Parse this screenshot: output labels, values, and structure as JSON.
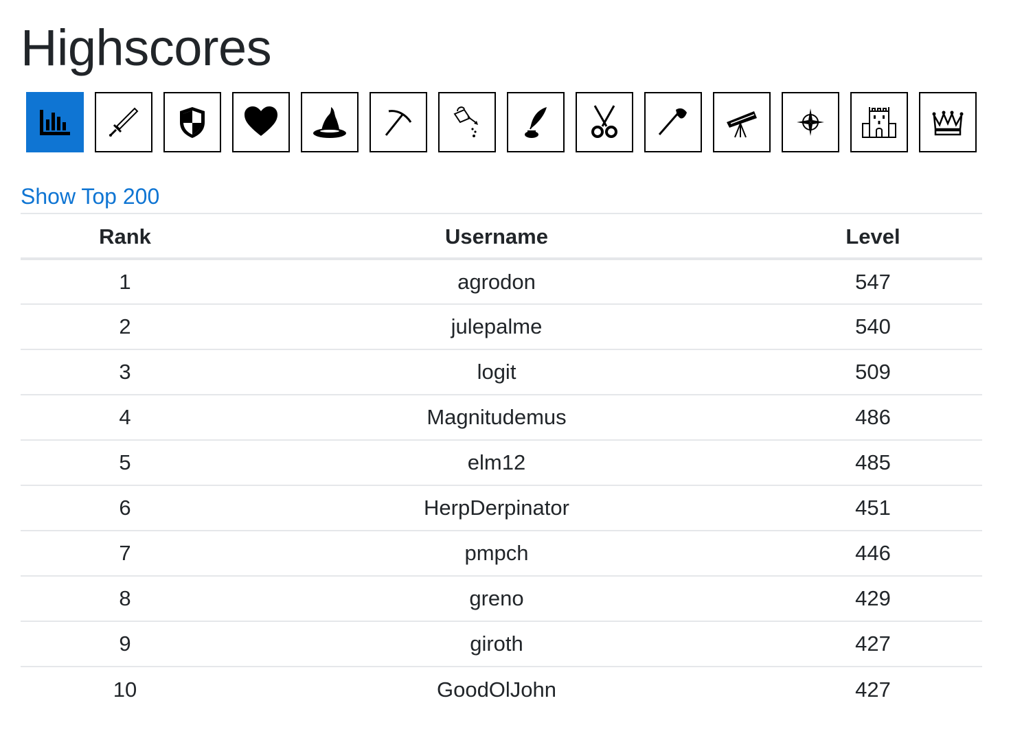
{
  "page": {
    "title": "Highscores"
  },
  "skills": [
    {
      "icon": "bar-chart-icon",
      "active": true
    },
    {
      "icon": "sword-icon",
      "active": false
    },
    {
      "icon": "shield-icon",
      "active": false
    },
    {
      "icon": "heart-icon",
      "active": false
    },
    {
      "icon": "wizard-hat-icon",
      "active": false
    },
    {
      "icon": "pickaxe-icon",
      "active": false
    },
    {
      "icon": "watering-can-icon",
      "active": false
    },
    {
      "icon": "quill-ink-icon",
      "active": false
    },
    {
      "icon": "scissors-icon",
      "active": false
    },
    {
      "icon": "axe-icon",
      "active": false
    },
    {
      "icon": "telescope-icon",
      "active": false
    },
    {
      "icon": "compass-icon",
      "active": false
    },
    {
      "icon": "castle-tower-icon",
      "active": false
    },
    {
      "icon": "crown-icon",
      "active": false
    }
  ],
  "show_top_link": "Show Top 200",
  "table": {
    "headers": {
      "rank": "Rank",
      "username": "Username",
      "level": "Level"
    },
    "rows": [
      {
        "rank": "1",
        "username": "agrodon",
        "level": "547"
      },
      {
        "rank": "2",
        "username": "julepalme",
        "level": "540"
      },
      {
        "rank": "3",
        "username": "logit",
        "level": "509"
      },
      {
        "rank": "4",
        "username": "Magnitudemus",
        "level": "486"
      },
      {
        "rank": "5",
        "username": "elm12",
        "level": "485"
      },
      {
        "rank": "6",
        "username": "HerpDerpinator",
        "level": "451"
      },
      {
        "rank": "7",
        "username": "pmpch",
        "level": "446"
      },
      {
        "rank": "8",
        "username": "greno",
        "level": "429"
      },
      {
        "rank": "9",
        "username": "giroth",
        "level": "427"
      },
      {
        "rank": "10",
        "username": "GoodOlJohn",
        "level": "427"
      }
    ]
  },
  "colors": {
    "accent": "#0f75d3",
    "text": "#212529",
    "divider": "#e5e7ea"
  }
}
